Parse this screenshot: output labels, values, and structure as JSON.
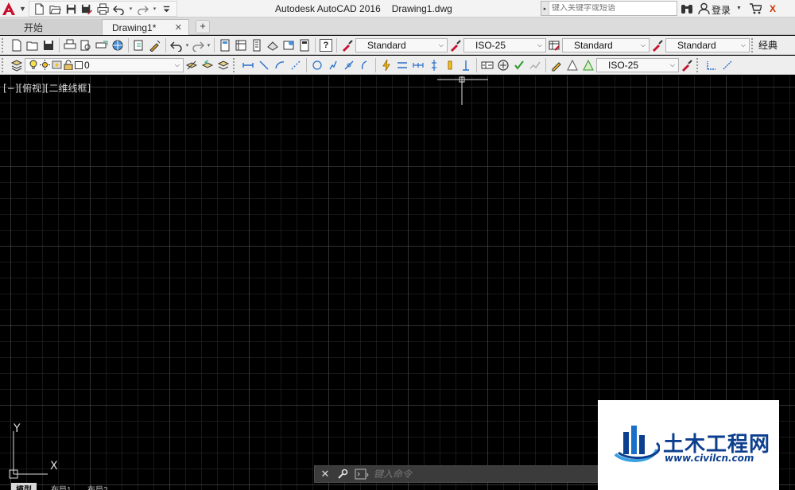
{
  "titlebar": {
    "app_name": "Autodesk AutoCAD 2016",
    "file_name": "Drawing1.dwg",
    "search_placeholder": "键入关键字或短语",
    "login_label": "登录",
    "exchange_label": "X"
  },
  "tabs": {
    "start_label": "开始",
    "drawing_label": "Drawing1*",
    "close_glyph": "✕",
    "new_tab_glyph": "+"
  },
  "toolbar1": {
    "text_style": "Standard",
    "dim_style": "ISO-25",
    "table_style": "Standard",
    "multileader_style": "Standard",
    "workspace_partial": "经典"
  },
  "toolbar2": {
    "layer_name": "0",
    "dim_style": "ISO-25"
  },
  "viewport": {
    "label": "[−][俯视][二维线框]"
  },
  "ucs": {
    "y_label": "Y",
    "x_label": "X"
  },
  "command_line": {
    "placeholder": "键入命令"
  },
  "layout_tabs": {
    "model": "模型",
    "layout1": "布局1",
    "layout2": "布局2"
  },
  "watermark": {
    "title": "土木工程网",
    "url": "www.civilcn.com"
  },
  "colors": {
    "canvas_bg": "#000000",
    "autocad_red": "#c8102e",
    "watermark_blue": "#0c3f8e"
  }
}
